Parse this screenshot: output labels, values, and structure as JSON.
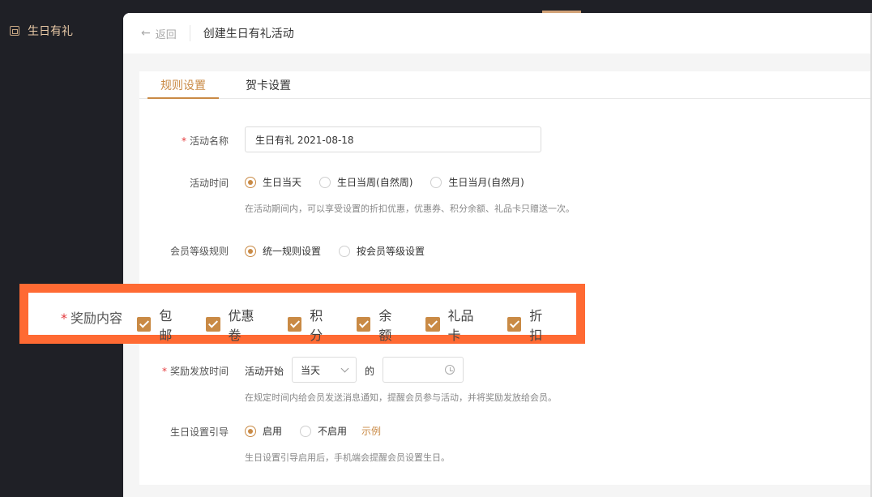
{
  "sidebar": {
    "item_label": "生日有礼",
    "item_icon": "gift-box-icon"
  },
  "header": {
    "back_label": "返回",
    "title": "创建生日有礼活动"
  },
  "tabs": [
    {
      "label": "规则设置",
      "active": true
    },
    {
      "label": "贺卡设置",
      "active": false
    }
  ],
  "form": {
    "name": {
      "label": "活动名称",
      "value": "生日有礼  2021-08-18",
      "required": true
    },
    "time": {
      "label": "活动时间",
      "options": [
        {
          "label": "生日当天",
          "selected": true
        },
        {
          "label": "生日当周(自然周)",
          "selected": false
        },
        {
          "label": "生日当月(自然月)",
          "selected": false
        }
      ],
      "hint": "在活动期间内，可以享受设置的折扣优惠，优惠券、积分余额、礼品卡只赠送一次。"
    },
    "level": {
      "label": "会员等级规则",
      "options": [
        {
          "label": "统一规则设置",
          "selected": true
        },
        {
          "label": "按会员等级设置",
          "selected": false
        }
      ]
    },
    "rewards": {
      "label": "奖励内容",
      "required": true,
      "items": [
        {
          "label": "包邮",
          "checked": true
        },
        {
          "label": "优惠卷",
          "checked": true
        },
        {
          "label": "积分",
          "checked": true
        },
        {
          "label": "余额",
          "checked": true
        },
        {
          "label": "礼品卡",
          "checked": true
        },
        {
          "label": "折扣",
          "checked": true
        }
      ]
    },
    "send_time": {
      "label": "奖励发放时间",
      "required": true,
      "prefix": "活动开始",
      "select_value": "当天",
      "middle": "的",
      "time_value": "",
      "hint": "在规定时间内给会员发送消息通知，提醒会员参与活动，并将奖励发放给会员。"
    },
    "guide": {
      "label": "生日设置引导",
      "options": [
        {
          "label": "启用",
          "selected": true
        },
        {
          "label": "不启用",
          "selected": false
        }
      ],
      "example_link": "示例",
      "hint": "生日设置引导启用后，手机端会提醒会员设置生日。"
    }
  },
  "colors": {
    "accent": "#c98a45",
    "highlight": "#ff6a33",
    "sidebar": "#1f2026"
  }
}
